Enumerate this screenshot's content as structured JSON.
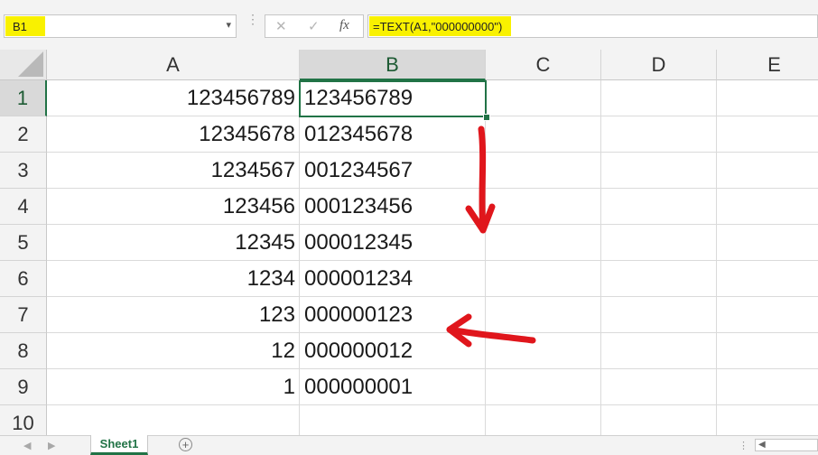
{
  "formula_bar": {
    "name_box": "B1",
    "formula": "=TEXT(A1,\"000000000\")",
    "icons": [
      "chevron-down-icon",
      "cancel-icon",
      "enter-check-icon",
      "function-fx-icon"
    ],
    "highlight_color": "#f9f100"
  },
  "grid": {
    "columns": [
      "A",
      "B",
      "C",
      "D",
      "E"
    ],
    "rows": [
      "1",
      "2",
      "3",
      "4",
      "5",
      "6",
      "7",
      "8",
      "9",
      "10"
    ],
    "column_a": [
      "123456789",
      "12345678",
      "1234567",
      "123456",
      "12345",
      "1234",
      "123",
      "12",
      "1"
    ],
    "column_b": [
      "123456789",
      "012345678",
      "001234567",
      "000123456",
      "000012345",
      "000001234",
      "000000123",
      "000000012",
      "000000001"
    ],
    "selected_cell": "B1",
    "accent_color": "#217346"
  },
  "annotations": {
    "arrow_color": "#e0161c",
    "arrows": [
      "down-arrow",
      "left-arrow"
    ]
  },
  "sheet_tabs": {
    "tabs": [
      "Sheet1"
    ],
    "active": "Sheet1",
    "add_icon": "plus-icon"
  }
}
